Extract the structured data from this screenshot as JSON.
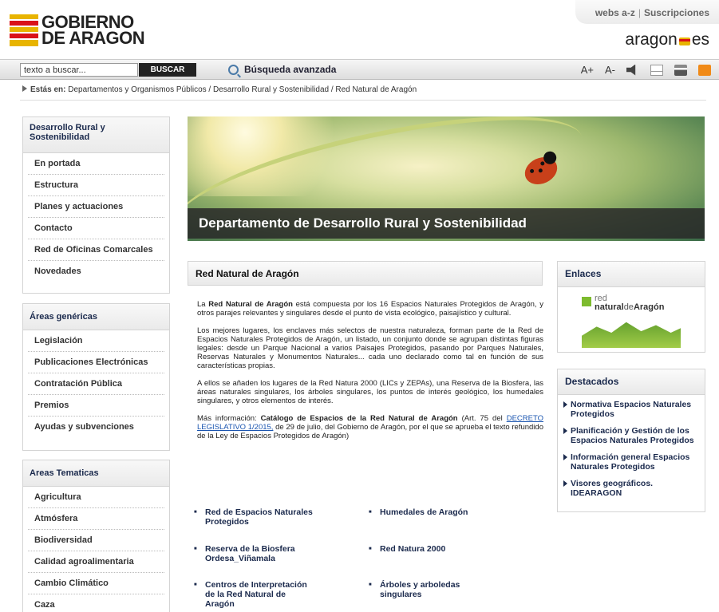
{
  "header": {
    "logo_line1": "GOBIERNO",
    "logo_line2": "DE ARAGON",
    "links": [
      "webs a-z",
      "Suscripciones"
    ],
    "portal_logo_left": "aragon",
    "portal_logo_right": "es"
  },
  "search": {
    "value": "texto a buscar...",
    "button_label": "BUSCAR",
    "advanced_label": "Búsqueda avanzada"
  },
  "tools": {
    "font_increase": "A+",
    "font_decrease": "A-",
    "icons": [
      "speaker-icon",
      "mail-icon",
      "print-icon",
      "rss-icon"
    ]
  },
  "breadcrumb": {
    "prefix": "Estás en:",
    "path": "Departamentos y Organismos Públicos / Desarrollo Rural y Sostenibilidad / Red Natural de Aragón"
  },
  "sidebar": {
    "section1": {
      "title": "Desarrollo Rural y Sostenibilidad",
      "items": [
        "En portada",
        "Estructura",
        "Planes y actuaciones",
        "Contacto",
        "Red de Oficinas Comarcales",
        "Novedades"
      ]
    },
    "section2": {
      "title": "Áreas genéricas",
      "items": [
        "Legislación",
        "Publicaciones Electrónicas",
        "Contratación Pública",
        "Premios",
        "Ayudas y subvenciones"
      ]
    },
    "section3": {
      "title": "Areas Tematicas",
      "items": [
        "Agricultura",
        "Atmósfera",
        "Biodiversidad",
        "Calidad agroalimentaria",
        "Cambio Climático",
        "Caza"
      ]
    }
  },
  "banner": {
    "title": "Departamento de Desarrollo Rural y Sostenibilidad"
  },
  "main": {
    "title": "Red Natural de Aragón",
    "p1_pre": "La ",
    "p1_bold": "Red Natural de Aragón",
    "p1_post": " está compuesta por los 16 Espacios Naturales Protegidos de Aragón, y otros parajes relevantes y singulares desde el punto de vista ecológico, paisajístico y cultural.",
    "p2": "Los mejores lugares, los enclaves más selectos de nuestra naturaleza, forman parte de la Red de Espacios Naturales Protegidos de Aragón, un listado, un conjunto donde se agrupan distintas figuras legales: desde un Parque Nacional a varios Paisajes Protegidos, pasando por Parques Naturales, Reservas Naturales y Monumentos Naturales... cada uno declarado como tal en función de sus características propias.",
    "p3": "A ellos se añaden los lugares de la Red Natura 2000 (LICs y ZEPAs), una Reserva de la Biosfera, las áreas naturales singulares, los árboles singulares, los puntos de interés geológico, los humedales singulares,  y otros elementos de interés.",
    "p4_pre": "Más información: ",
    "p4_bold": "Catálogo de Espacios de la Red Natural de Aragón",
    "p4_mid": " (Art. 75 del ",
    "p4_link": "DECRETO LEGISLATIVO 1/2015,",
    "p4_post": " de 29 de julio, del Gobierno de Aragón, por el que se aprueba el texto refundido de la Ley de Espacios Protegidos de Aragón)",
    "links": [
      "Red de Espacios Naturales Protegidos",
      "Humedales de Aragón",
      "Reserva de la Biosfera Ordesa_Viñamala",
      "Red Natura 2000",
      "Centros de Interpretación de la Red Natural de Aragón",
      "Árboles y arboledas singulares"
    ]
  },
  "enlaces": {
    "title": "Enlaces",
    "logo_small": "red",
    "logo_main1": "natural",
    "logo_main2": "de",
    "logo_main3": "Aragón"
  },
  "destacados": {
    "title": "Destacados",
    "items": [
      "Normativa Espacios Naturales Protegidos",
      "Planificación y Gestión de los Espacios Naturales Protegidos",
      "Información general Espacios Naturales Protegidos",
      "Visores geográficos. IDEARAGON"
    ]
  }
}
